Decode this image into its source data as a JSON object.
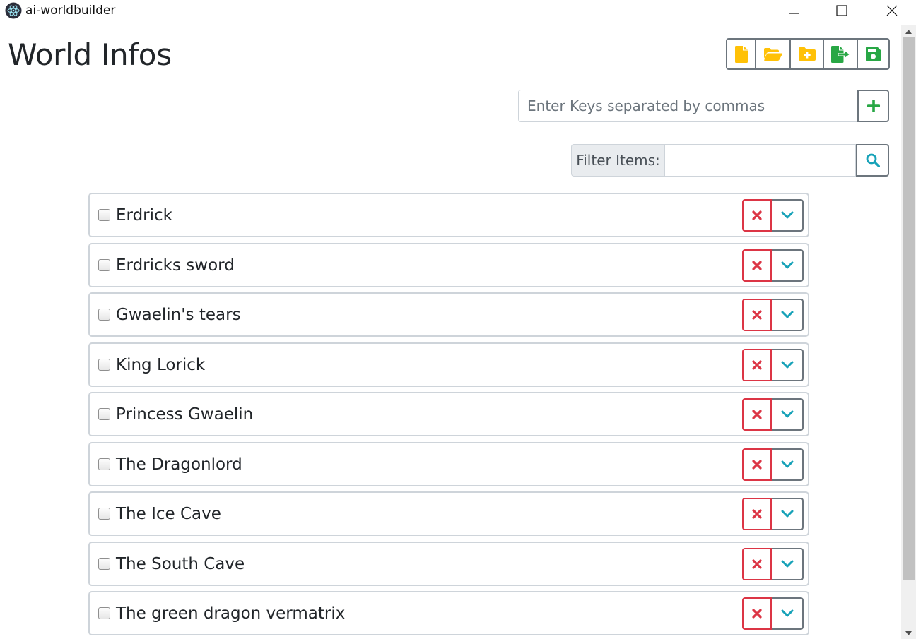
{
  "window": {
    "app_title": "ai-worldbuilder",
    "app_icon": "electron-atom-icon",
    "controls": [
      "minimize-icon",
      "maximize-icon",
      "close-icon"
    ]
  },
  "page": {
    "title": "World Infos"
  },
  "toolbar": {
    "buttons": [
      {
        "name": "new-file",
        "icon": "file-icon",
        "color": "#ffc107"
      },
      {
        "name": "open-folder",
        "icon": "folder-open-icon",
        "color": "#ffc107"
      },
      {
        "name": "new-folder",
        "icon": "folder-plus-icon",
        "color": "#ffc107"
      },
      {
        "name": "export",
        "icon": "file-export-icon",
        "color": "#28a745"
      },
      {
        "name": "save",
        "icon": "save-icon",
        "color": "#28a745"
      }
    ]
  },
  "keys": {
    "placeholder": "Enter Keys separated by commas",
    "value": "",
    "add_icon": "plus-icon"
  },
  "filter": {
    "label": "Filter Items:",
    "value": "",
    "search_icon": "search-icon"
  },
  "items": [
    {
      "label": "Erdrick",
      "checked": false
    },
    {
      "label": "Erdricks sword",
      "checked": false
    },
    {
      "label": "Gwaelin's tears",
      "checked": false
    },
    {
      "label": "King Lorick",
      "checked": false
    },
    {
      "label": "Princess Gwaelin",
      "checked": false
    },
    {
      "label": "The Dragonlord",
      "checked": false
    },
    {
      "label": "The Ice Cave",
      "checked": false
    },
    {
      "label": "The South Cave",
      "checked": false
    },
    {
      "label": "The green dragon vermatrix",
      "checked": false
    }
  ],
  "colors": {
    "danger": "#dc3545",
    "info": "#17a2b8",
    "success": "#28a745",
    "warning": "#ffc107",
    "secondary": "#6c757d"
  }
}
